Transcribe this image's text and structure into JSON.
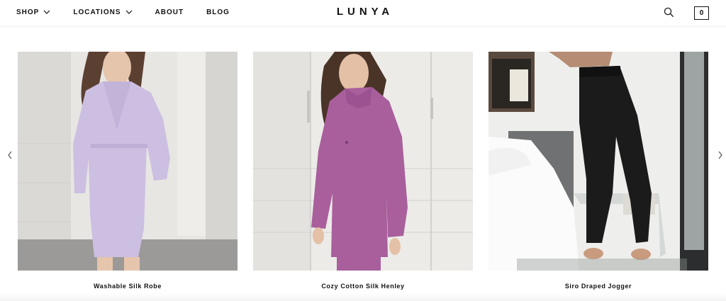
{
  "header": {
    "nav": [
      {
        "label": "SHOP",
        "has_dropdown": true
      },
      {
        "label": "LOCATIONS",
        "has_dropdown": true
      },
      {
        "label": "ABOUT",
        "has_dropdown": false
      },
      {
        "label": "BLOG",
        "has_dropdown": false
      }
    ],
    "logo": "LUNYA",
    "search_icon": "search-icon",
    "cart_count": "0"
  },
  "carousel": {
    "prev_icon": "chevron-left-icon",
    "next_icon": "chevron-right-icon",
    "products": [
      {
        "name": "Washable Silk Robe",
        "color": "#cdbfe1"
      },
      {
        "name": "Cozy Cotton Silk Henley",
        "color": "#a85f9c"
      },
      {
        "name": "Siro Draped Jogger",
        "color": "#1b1b1b"
      }
    ]
  }
}
